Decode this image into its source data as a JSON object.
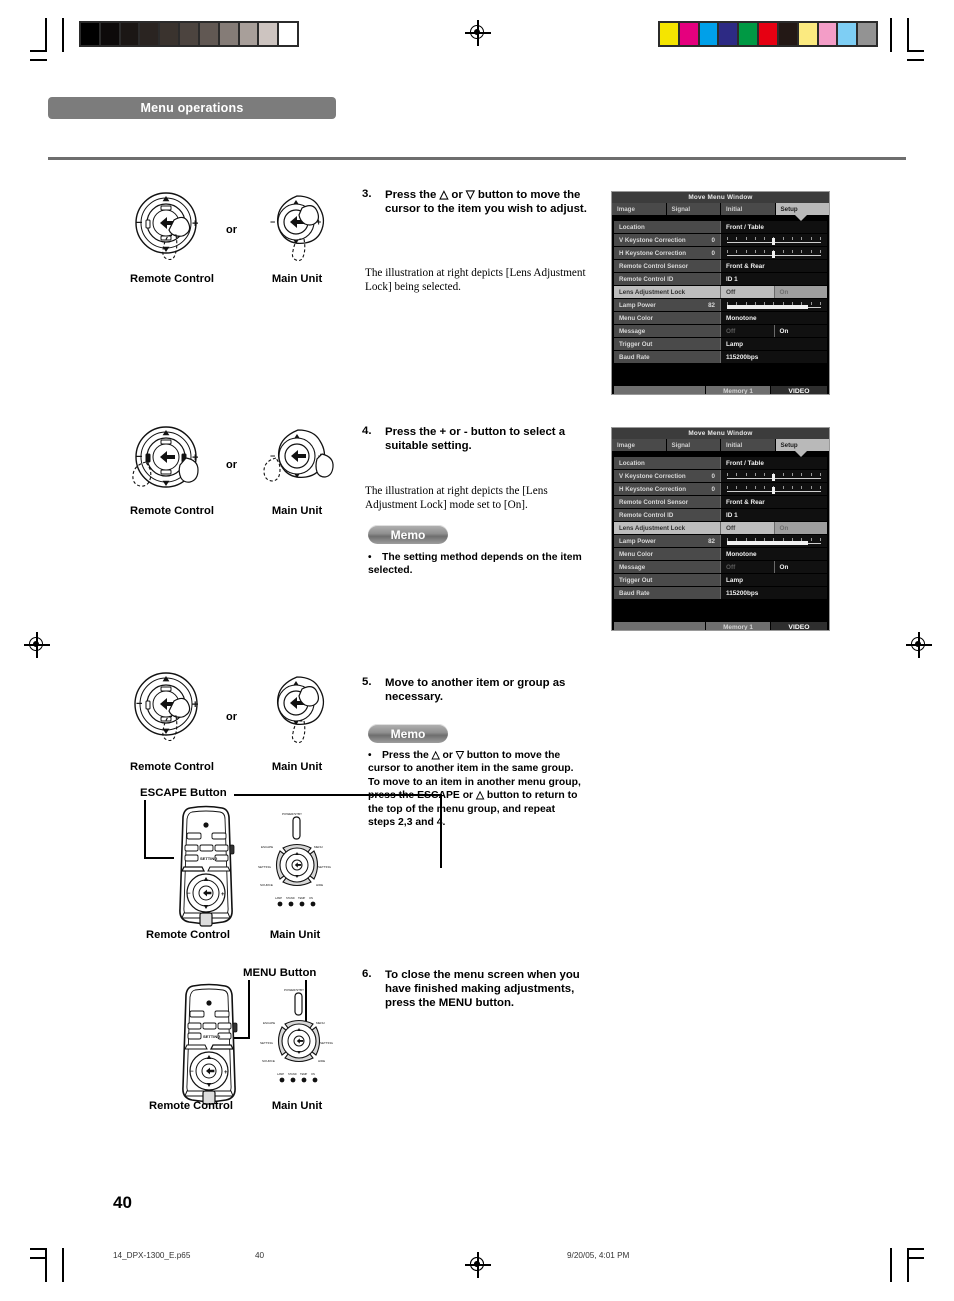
{
  "page": {
    "section_title": "Menu operations",
    "page_number": "40",
    "footer_file": "14_DPX-1300_E.p65",
    "footer_page": "40",
    "footer_date": "9/20/05, 4:01 PM"
  },
  "labels": {
    "remote_control": "Remote Control",
    "main_unit": "Main Unit",
    "or": "or",
    "escape_button": "ESCAPE Button",
    "menu_button": "MENU Button",
    "memo": "Memo"
  },
  "steps": [
    {
      "number": "3.",
      "text": "Press the △ or ▽ button to move the cursor to the item you wish to adjust.",
      "caption": "The illustration at right depicts [Lens Adjustment Lock] being selected."
    },
    {
      "number": "4.",
      "text": "Press the + or - button to select a suitable setting.",
      "caption": "The illustration at right depicts the  [Lens Adjustment Lock] mode set to [On].",
      "memo": "The setting method depends on the item selected."
    },
    {
      "number": "5.",
      "text": "Move to another item or group as necessary.",
      "memo": "Press the △ or ▽ button to move the cursor to another item in the same group.\nTo move to an item in another menu group, press the ESCAPE or △ button to return to the top of the menu group, and repeat steps 2,3 and 4."
    },
    {
      "number": "6.",
      "text": "To close the menu screen when you have finished making adjustments, press the MENU button."
    }
  ],
  "osd": {
    "title": "Move Menu Window",
    "tabs": [
      {
        "label": "Image",
        "selected": false
      },
      {
        "label": "Signal",
        "selected": false
      },
      {
        "label": "Initial",
        "selected": false
      },
      {
        "label": "Setup",
        "selected": true
      }
    ],
    "footer": {
      "memory": "Memory 1",
      "source": "VIDEO"
    },
    "rows_a": [
      {
        "label": "Location",
        "type": "value",
        "value": "Front / Table",
        "highlight": false
      },
      {
        "label": "V Keystone Correction",
        "type": "slider",
        "number": "0",
        "position": 50,
        "highlight": false
      },
      {
        "label": "H Keystone Correction",
        "type": "slider",
        "number": "0",
        "position": 50,
        "highlight": false
      },
      {
        "label": "Remote Control Sensor",
        "type": "value",
        "value": "Front & Rear",
        "highlight": false
      },
      {
        "label": "Remote Control ID",
        "type": "value",
        "value": "ID 1",
        "highlight": false
      },
      {
        "label": "Lens Adjustment Lock",
        "type": "toggle",
        "options": [
          "Off",
          "On"
        ],
        "selected": 0,
        "highlight": true
      },
      {
        "label": "Lamp Power",
        "type": "bar",
        "number": "82",
        "fill": 82,
        "highlight": false
      },
      {
        "label": "Menu Color",
        "type": "value",
        "value": "Monotone",
        "highlight": false
      },
      {
        "label": "Message",
        "type": "toggle",
        "options": [
          "Off",
          "On"
        ],
        "selected": 1,
        "highlight": false
      },
      {
        "label": "Trigger Out",
        "type": "value",
        "value": "Lamp",
        "highlight": false
      },
      {
        "label": "Baud Rate",
        "type": "value",
        "value": "115200bps",
        "highlight": false
      }
    ],
    "rows_b": [
      {
        "label": "Location",
        "type": "value",
        "value": "Front / Table",
        "highlight": false
      },
      {
        "label": "V Keystone Correction",
        "type": "slider",
        "number": "0",
        "position": 50,
        "highlight": false
      },
      {
        "label": "H Keystone Correction",
        "type": "slider",
        "number": "0",
        "position": 50,
        "highlight": false
      },
      {
        "label": "Remote Control Sensor",
        "type": "value",
        "value": "Front & Rear",
        "highlight": false
      },
      {
        "label": "Remote Control ID",
        "type": "value",
        "value": "ID 1",
        "highlight": false
      },
      {
        "label": "Lens Adjustment Lock",
        "type": "toggle",
        "options": [
          "Off",
          "On"
        ],
        "selected": 0,
        "highlight": true
      },
      {
        "label": "Lamp Power",
        "type": "bar",
        "number": "82",
        "fill": 82,
        "highlight": false
      },
      {
        "label": "Menu Color",
        "type": "value",
        "value": "Monotone",
        "highlight": false
      },
      {
        "label": "Message",
        "type": "toggle",
        "options": [
          "Off",
          "On"
        ],
        "selected": 1,
        "highlight": false
      },
      {
        "label": "Trigger Out",
        "type": "value",
        "value": "Lamp",
        "highlight": false
      },
      {
        "label": "Baud Rate",
        "type": "value",
        "value": "115200bps",
        "highlight": false
      }
    ]
  },
  "colorbars": {
    "grayscale": [
      "#000000",
      "#0d0a0a",
      "#1b1715",
      "#2a2421",
      "#3a332e",
      "#4c443f",
      "#615853",
      "#857c77",
      "#a89f9a",
      "#cdc4c0",
      "#ffffff"
    ],
    "chroma": [
      "#f5e500",
      "#e5007e",
      "#00a0e9",
      "#2d2a84",
      "#009944",
      "#e60012",
      "#231815",
      "#fbea80",
      "#f39dc7",
      "#7ecef4",
      "#939393"
    ]
  }
}
